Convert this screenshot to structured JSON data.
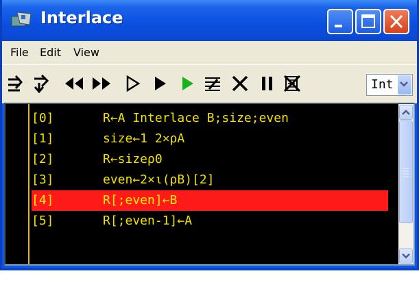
{
  "window": {
    "title": "Interlace",
    "icon": "dyalog-apl-icon",
    "caption_buttons": [
      "minimize-icon",
      "maximize-icon",
      "close-icon"
    ]
  },
  "menu": {
    "items": [
      {
        "label": "File",
        "mnemonic": "F"
      },
      {
        "label": "Edit",
        "mnemonic": "E"
      },
      {
        "label": "View",
        "mnemonic": "V"
      }
    ]
  },
  "toolbar": {
    "icons": [
      "execute-line-icon",
      "trace-into-icon",
      "backward-icon",
      "forward-icon",
      "continue-icon",
      "run-icon",
      "restart-thread-icon",
      "edit-icon",
      "quit-icon",
      "pause-icon",
      "interrupt-icon"
    ],
    "combo_value": "Int"
  },
  "code": {
    "lines": [
      {
        "num": "[0]",
        "text": "R←A Interlace B;size;even",
        "current": false
      },
      {
        "num": "[1]",
        "text": "size←1 2×⍴A",
        "current": false
      },
      {
        "num": "[2]",
        "text": "R←size⍴0",
        "current": false
      },
      {
        "num": "[3]",
        "text": "even←2×⍳(⍴B)[2]",
        "current": false
      },
      {
        "num": "[4]",
        "text": "R[;even]←B",
        "current": true
      },
      {
        "num": "[5]",
        "text": "R[;even-1]←A",
        "current": false
      }
    ]
  },
  "colors": {
    "code_text": "#f2e000",
    "code_background": "#000000",
    "current_line": "#ff1a1a",
    "title_bar": "#0b4fdf"
  }
}
